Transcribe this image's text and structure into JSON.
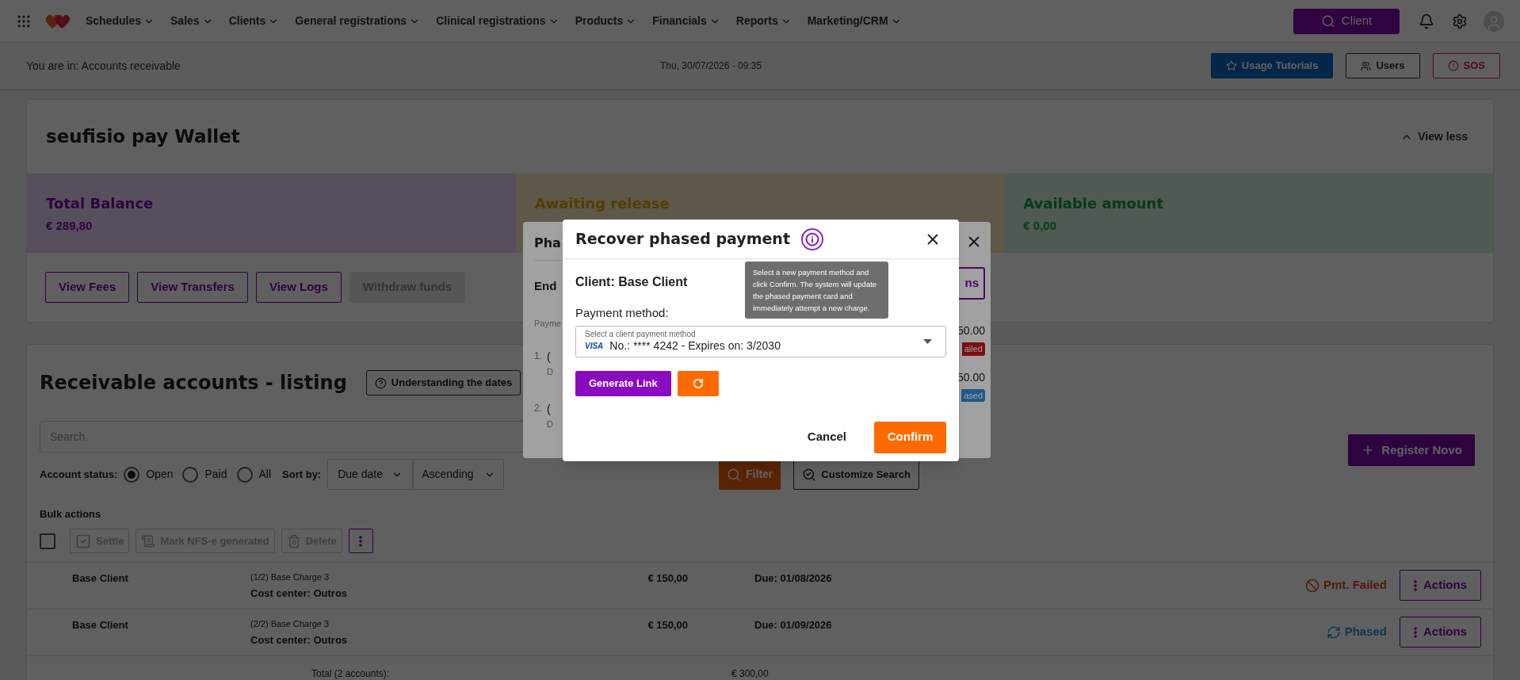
{
  "nav": {
    "menu": [
      {
        "label": "Schedules"
      },
      {
        "label": "Sales"
      },
      {
        "label": "Clients"
      },
      {
        "label": "General registrations"
      },
      {
        "label": "Clinical registrations"
      },
      {
        "label": "Products"
      },
      {
        "label": "Financials"
      },
      {
        "label": "Reports"
      },
      {
        "label": "Marketing/CRM"
      }
    ],
    "client_button": "Client"
  },
  "breadcrumb": {
    "location": "You are in: Accounts receivable",
    "datetime": "Thu, 30/07/2026 - 09:35",
    "buttons": [
      {
        "label": "Usage Tutorials",
        "kind": "primary"
      },
      {
        "label": "Users",
        "kind": "outline"
      },
      {
        "label": "SOS",
        "kind": "danger"
      }
    ]
  },
  "wallet": {
    "title": "seufisio pay Wallet",
    "toggle": "View less",
    "panels": [
      {
        "label": "Total Balance",
        "amount": "€ 289,80",
        "kind": "purple"
      },
      {
        "label": "Awaiting release",
        "kind": "yellow"
      },
      {
        "label": "Available amount",
        "amount": "€ 0,00",
        "kind": "green"
      }
    ],
    "buttons": [
      {
        "label": "View Fees",
        "disabled": false
      },
      {
        "label": "View Transfers",
        "disabled": false
      },
      {
        "label": "View Logs",
        "disabled": false
      },
      {
        "label": "Withdraw funds",
        "disabled": true
      }
    ]
  },
  "listing": {
    "title": "Receivable accounts - listing",
    "help_button": "Understanding the dates",
    "search": {
      "placeholder": "Search"
    },
    "status_label": "Account status:",
    "statuses": [
      {
        "label": "Open",
        "selected": true
      },
      {
        "label": "Paid",
        "selected": false
      },
      {
        "label": "All",
        "selected": false
      }
    ],
    "sort_label": "Sort by:",
    "sort_field": "Due date",
    "sort_order": "Ascending",
    "filter_button": "Filter",
    "customize_button": "Customize Search",
    "register_button": "Register Novo",
    "bulk_label": "Bulk actions",
    "bulk_checked": false,
    "bulk_buttons": [
      {
        "label": "Settle",
        "kind": "settle",
        "disabled": true
      },
      {
        "label": "Mark NFS-e generated",
        "kind": "nfse",
        "disabled": true
      },
      {
        "label": "Delete",
        "kind": "delete",
        "disabled": true
      }
    ],
    "rows": [
      {
        "client": "Base Client",
        "description": "(1/2) Base Charge 3",
        "cost_center": "Cost center: Outros",
        "amount": "€ 150,00",
        "due": "Due: 01/08/2026",
        "status": {
          "label": "Pmt. Failed",
          "kind": "failed"
        },
        "action": "Actions"
      },
      {
        "client": "Base Client",
        "description": "(2/2) Base Charge 3",
        "cost_center": "Cost center: Outros",
        "amount": "€ 150,00",
        "due": "Due: 01/09/2026",
        "status": {
          "label": "Phased",
          "kind": "phased"
        },
        "action": "Actions"
      }
    ],
    "total_label": "Total (2 accounts):",
    "total_amount": "€ 300,00"
  },
  "back_modal": {
    "title": "Pha",
    "section": "End",
    "column": "Payme",
    "button": "ns",
    "items": [
      {
        "index": "1.",
        "text": "(",
        "sub": "D",
        "amount": "50.00",
        "badge": "ailed",
        "kind": "failed"
      },
      {
        "index": "2.",
        "text": "(",
        "sub": "D",
        "amount": "50.00",
        "badge": "ased",
        "kind": "phased"
      }
    ]
  },
  "modal": {
    "title": "Recover phased payment",
    "tooltip": "Select a new payment method and click Confirm. The system will update the phased payment card and immediately attempt a new charge.",
    "client": "Client: Base Client",
    "payment_label": "Payment method:",
    "select": {
      "label": "Select a client payment method",
      "card_brand": "VISA",
      "value": "No.: **** 4242 - Expires on: 3/2030"
    },
    "generate_button": "Generate Link",
    "cancel": "Cancel",
    "confirm": "Confirm"
  }
}
